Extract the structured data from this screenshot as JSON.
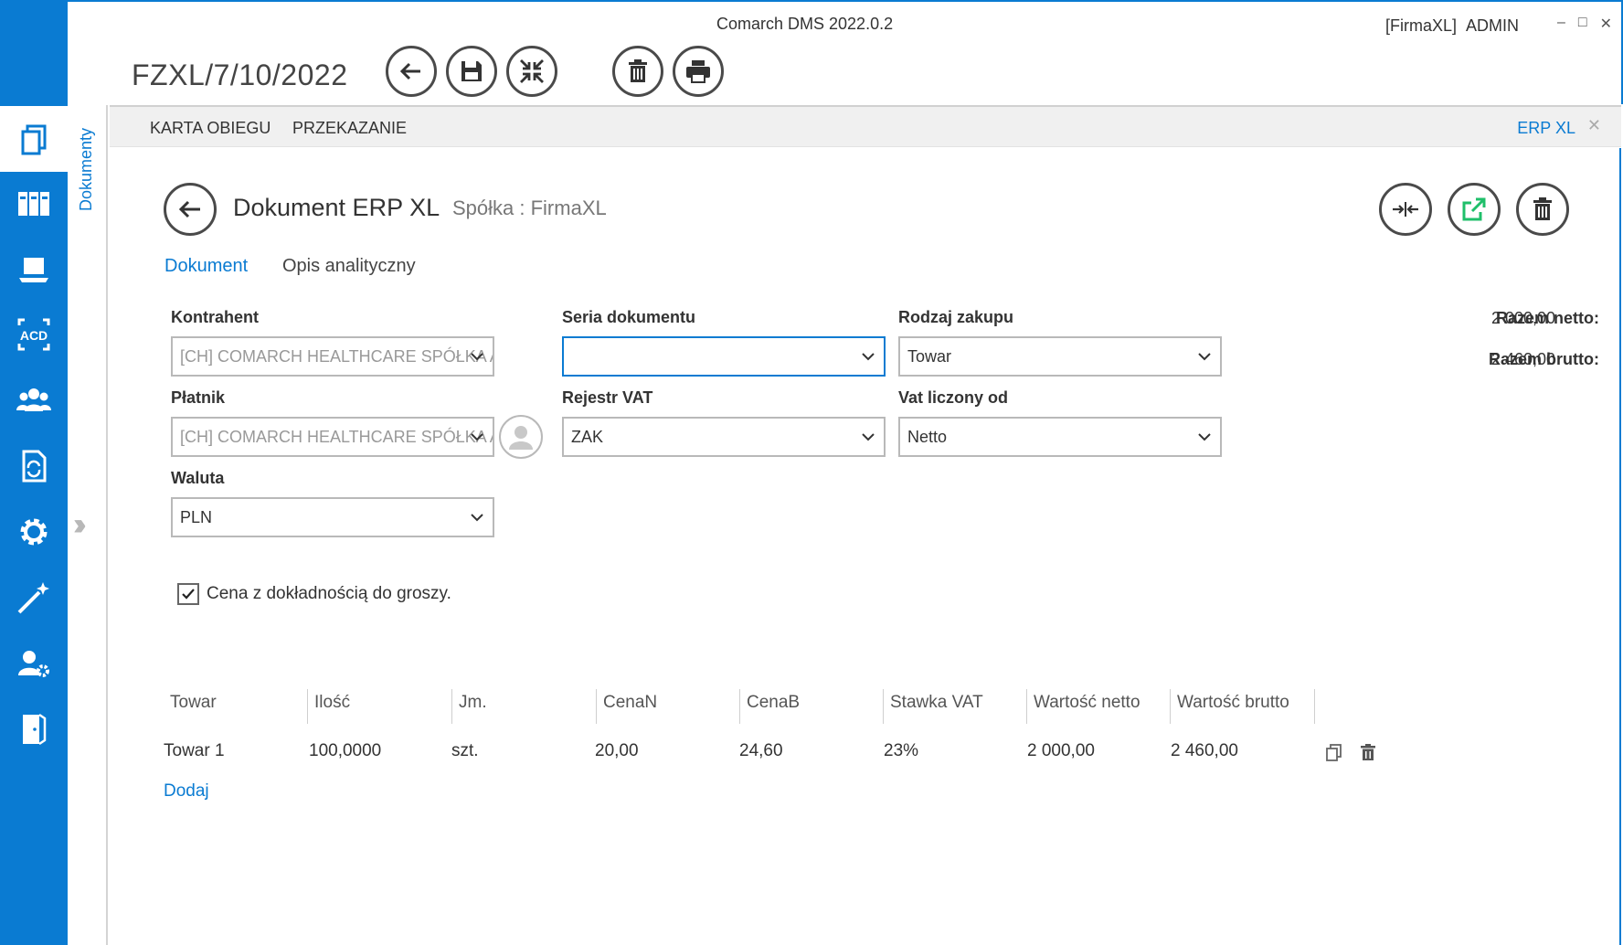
{
  "window": {
    "app_title": "Comarch DMS 2022.0.2",
    "company_user": "[FirmaXL]  ADMIN",
    "controls": [
      "–",
      "□",
      "✕"
    ]
  },
  "header": {
    "doc_number": "FZXL/7/10/2022",
    "toolbar_icons": [
      "back-arrow-icon",
      "save-icon",
      "collapse-icon",
      "trash-icon",
      "print-icon"
    ]
  },
  "sidebar": {
    "panel_label": "Dokumenty",
    "items": [
      {
        "icon": "documents-icon",
        "active": true
      },
      {
        "icon": "binders-icon"
      },
      {
        "icon": "laptop-icon"
      },
      {
        "icon": "acd-scan-icon",
        "text": "ACD"
      },
      {
        "icon": "users-icon"
      },
      {
        "icon": "document-sync-icon"
      },
      {
        "icon": "gear-icon"
      },
      {
        "icon": "magic-wand-icon"
      },
      {
        "icon": "user-settings-icon"
      },
      {
        "icon": "logout-door-icon"
      }
    ]
  },
  "tabstrip": {
    "tabs": [
      "KARTA OBIEGU",
      "PRZEKAZANIE"
    ],
    "active_tab": "ERP XL",
    "close": "✕"
  },
  "document": {
    "title": "Dokument ERP XL",
    "company_label": "Spółka :  FirmaXL",
    "subtabs": [
      "Dokument",
      "Opis analityczny"
    ],
    "fields": {
      "kontrahent": {
        "label": "Kontrahent",
        "value": "[CH] COMARCH HEALTHCARE SPÓŁKA AKCYJNA"
      },
      "platnik": {
        "label": "Płatnik",
        "value": "[CH] COMARCH HEALTHCARE SPÓŁKA AKCYJNA"
      },
      "waluta": {
        "label": "Waluta",
        "value": "PLN"
      },
      "seria": {
        "label": "Seria dokumentu",
        "value": ""
      },
      "rejestr": {
        "label": "Rejestr VAT",
        "value": "ZAK"
      },
      "rodzaj": {
        "label": "Rodzaj zakupu",
        "value": "Towar"
      },
      "vat_od": {
        "label": "Vat liczony od",
        "value": "Netto"
      }
    },
    "totals": {
      "netto_label": "Razem netto:",
      "netto_value": "2 000,00",
      "brutto_label": "Razem brutto:",
      "brutto_value": "2 460,00"
    },
    "checkbox": {
      "label": "Cena z dokładnością do groszy.",
      "checked": true
    },
    "table": {
      "columns": [
        "Towar",
        "Ilość",
        "Jm.",
        "CenaN",
        "CenaB",
        "Stawka VAT",
        "Wartość netto",
        "Wartość brutto"
      ],
      "rows": [
        [
          "Towar 1",
          "100,0000",
          "szt.",
          "20,00",
          "24,60",
          "23%",
          "2 000,00",
          "2 460,00"
        ]
      ]
    },
    "add_link": "Dodaj"
  },
  "colors": {
    "accent": "#0a7bd2",
    "green_icon": "#1fbf6a",
    "border": "#b9b9b9"
  }
}
